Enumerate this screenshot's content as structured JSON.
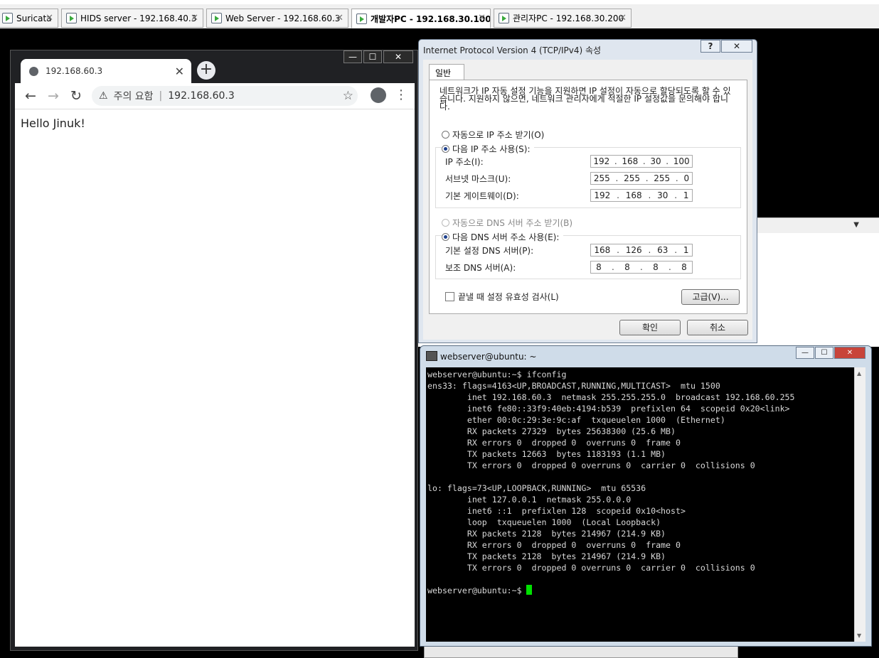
{
  "vm_tabs": [
    {
      "label": "Suricata",
      "active": false
    },
    {
      "label": "HIDS server - 192.168.40.3",
      "active": false
    },
    {
      "label": "Web Server - 192.168.60.3",
      "active": false
    },
    {
      "label": "개발자PC - 192.168.30.100",
      "active": true
    },
    {
      "label": "관리자PC - 192.168.30.200",
      "active": false
    }
  ],
  "browser": {
    "tab_title": "192.168.60.3",
    "security_label": "주의 요함",
    "url": "192.168.60.3",
    "page_text": "Hello Jinuk!"
  },
  "tcpip_dialog": {
    "title": "Internet Protocol Version 4 (TCP/IPv4) 속성",
    "help_label": "?",
    "tab_general": "일반",
    "description": "네트워크가 IP 자동 설정 기능을 지원하면 IP 설정이 자동으로 할당되도록 할 수 있습니다. 지원하지 않으면, 네트워크 관리자에게 적절한 IP 설정값을 문의해야 합니다.",
    "auto_ip": "자동으로 IP 주소 받기(O)",
    "manual_ip": "다음 IP 주소 사용(S):",
    "ip_label": "IP 주소(I):",
    "ip": [
      "192",
      "168",
      "30",
      "100"
    ],
    "subnet_label": "서브넷 마스크(U):",
    "subnet": [
      "255",
      "255",
      "255",
      "0"
    ],
    "gateway_label": "기본 게이트웨이(D):",
    "gateway": [
      "192",
      "168",
      "30",
      "1"
    ],
    "auto_dns": "자동으로 DNS 서버 주소 받기(B)",
    "manual_dns": "다음 DNS 서버 주소 사용(E):",
    "dns1_label": "기본 설정 DNS 서버(P):",
    "dns1": [
      "168",
      "126",
      "63",
      "1"
    ],
    "dns2_label": "보조 DNS 서버(A):",
    "dns2": [
      "8",
      "8",
      "8",
      "8"
    ],
    "validate_label": "끝낼 때 설정 유효성 검사(L)",
    "advanced_button": "고급(V)...",
    "ok_button": "확인",
    "cancel_button": "취소"
  },
  "terminal": {
    "title": "webserver@ubuntu: ~",
    "lines": [
      "webserver@ubuntu:~$ ifconfig",
      "ens33: flags=4163<UP,BROADCAST,RUNNING,MULTICAST>  mtu 1500",
      "        inet 192.168.60.3  netmask 255.255.255.0  broadcast 192.168.60.255",
      "        inet6 fe80::33f9:40eb:4194:b539  prefixlen 64  scopeid 0x20<link>",
      "        ether 00:0c:29:3e:9c:af  txqueuelen 1000  (Ethernet)",
      "        RX packets 27329  bytes 25638300 (25.6 MB)",
      "        RX errors 0  dropped 0  overruns 0  frame 0",
      "        TX packets 12663  bytes 1183193 (1.1 MB)",
      "        TX errors 0  dropped 0 overruns 0  carrier 0  collisions 0",
      "",
      "lo: flags=73<UP,LOOPBACK,RUNNING>  mtu 65536",
      "        inet 127.0.0.1  netmask 255.0.0.0",
      "        inet6 ::1  prefixlen 128  scopeid 0x10<host>",
      "        loop  txqueuelen 1000  (Local Loopback)",
      "        RX packets 2128  bytes 214967 (214.9 KB)",
      "        RX errors 0  dropped 0  overruns 0  frame 0",
      "        TX packets 2128  bytes 214967 (214.9 KB)",
      "        TX errors 0  dropped 0 overruns 0  carrier 0  collisions 0",
      ""
    ],
    "prompt": "webserver@ubuntu:~$"
  }
}
